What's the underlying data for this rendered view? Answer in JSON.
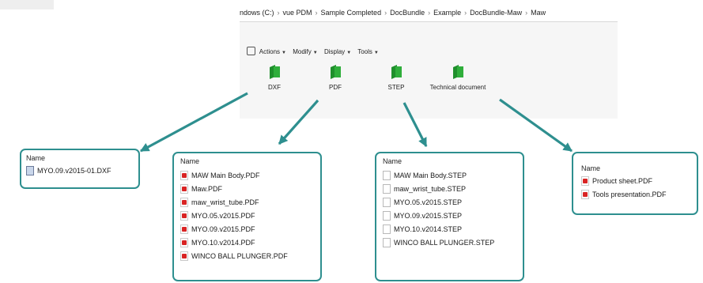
{
  "breadcrumb": [
    "ndows (C:)",
    "vue PDM",
    "Sample Completed",
    "DocBundle",
    "Example",
    "DocBundle-Maw",
    "Maw"
  ],
  "toolbar": [
    {
      "label": "Actions"
    },
    {
      "label": "Modify"
    },
    {
      "label": "Display"
    },
    {
      "label": "Tools"
    }
  ],
  "folders": [
    {
      "label": "DXF"
    },
    {
      "label": "PDF"
    },
    {
      "label": "STEP"
    },
    {
      "label": "Technical document"
    }
  ],
  "boxes": {
    "dxf": {
      "header": "Name",
      "files": [
        "MYO.09.v2015-01.DXF"
      ]
    },
    "pdf": {
      "header": "Name",
      "files": [
        "MAW Main Body.PDF",
        "Maw.PDF",
        "maw_wrist_tube.PDF",
        "MYO.05.v2015.PDF",
        "MYO.09.v2015.PDF",
        "MYO.10.v2014.PDF",
        "WINCO BALL PLUNGER.PDF"
      ]
    },
    "step": {
      "header": "Name",
      "files": [
        "MAW Main Body.STEP",
        "maw_wrist_tube.STEP",
        "MYO.05.v2015.STEP",
        "MYO.09.v2015.STEP",
        "MYO.10.v2014.STEP",
        "WINCO BALL PLUNGER.STEP"
      ]
    },
    "tech": {
      "header": "Name",
      "files": [
        "Product sheet.PDF",
        "Tools presentation.PDF"
      ]
    }
  },
  "colors": {
    "arrow": "#2e8f8f",
    "folder": "#2fae3b",
    "pdf_icon": "#d92424"
  }
}
